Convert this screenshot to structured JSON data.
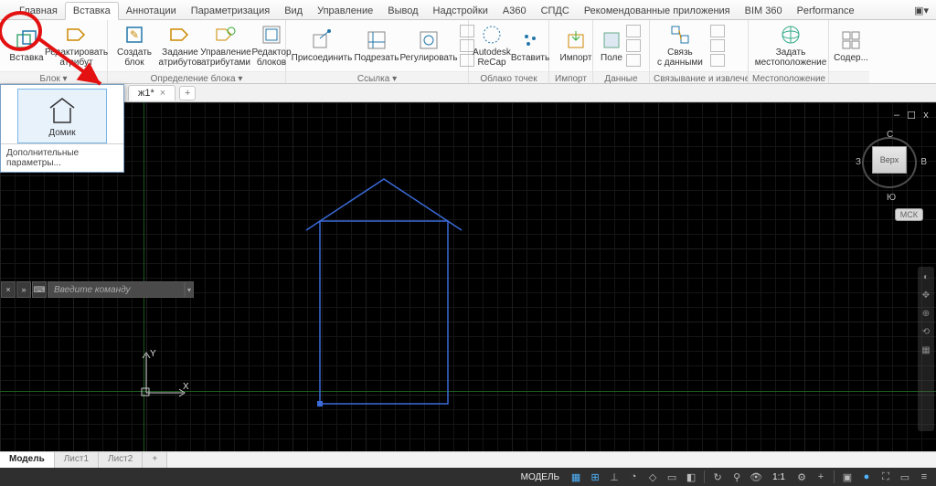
{
  "tabs": [
    "Главная",
    "Вставка",
    "Аннотации",
    "Параметризация",
    "Вид",
    "Управление",
    "Вывод",
    "Надстройки",
    "A360",
    "СПДС",
    "Рекомендованные приложения",
    "BIM 360",
    "Performance"
  ],
  "active_tab": "Вставка",
  "ribbon": {
    "p0": {
      "btn_insert": "Вставка",
      "btn_editattr": "Редактировать\nатрибут"
    },
    "p1": {
      "title": "Определение блока ▾",
      "create": "Создать\nблок",
      "define": "Задание\nатрибутов",
      "manage": "Управление\nатрибутами",
      "editor": "Редактор\nблоков"
    },
    "p2": {
      "title": "Ссылка ▾",
      "attach": "Присоединить",
      "clip": "Подрезать",
      "adjust": "Регулировать"
    },
    "p3": {
      "title": "Облако точек",
      "recap": "Autodesk\nReCap",
      "ins": "Вставить"
    },
    "p4": {
      "title": "Импорт",
      "imp": "Импорт"
    },
    "p5": {
      "title": "Данные",
      "field": "Поле"
    },
    "p6": {
      "title": "Связывание и извлечение",
      "link": "Связь\nс данными"
    },
    "p7": {
      "title": "Местоположение",
      "loc": "Задать\nместоположение"
    },
    "p8": {
      "cont": "Содер..."
    }
  },
  "gallery": {
    "item": "Домик",
    "more": "Дополнительные параметры..."
  },
  "file_tab": {
    "name": "ж1*",
    "plus": "+"
  },
  "viewport": {
    "cmd_placeholder": "Введите команду",
    "axis_y": "Y",
    "axis_x": "X",
    "cube_face": "Верх",
    "cube_n": "С",
    "cube_s": "Ю",
    "cube_w": "З",
    "cube_e": "В",
    "wcs": "МСК",
    "min": "–",
    "max": "☐",
    "close": "x"
  },
  "layout_tabs": [
    "Модель",
    "Лист1",
    "Лист2",
    "+"
  ],
  "status": {
    "model": "МОДЕЛЬ",
    "scale": "1:1",
    "gear": "⚙"
  }
}
